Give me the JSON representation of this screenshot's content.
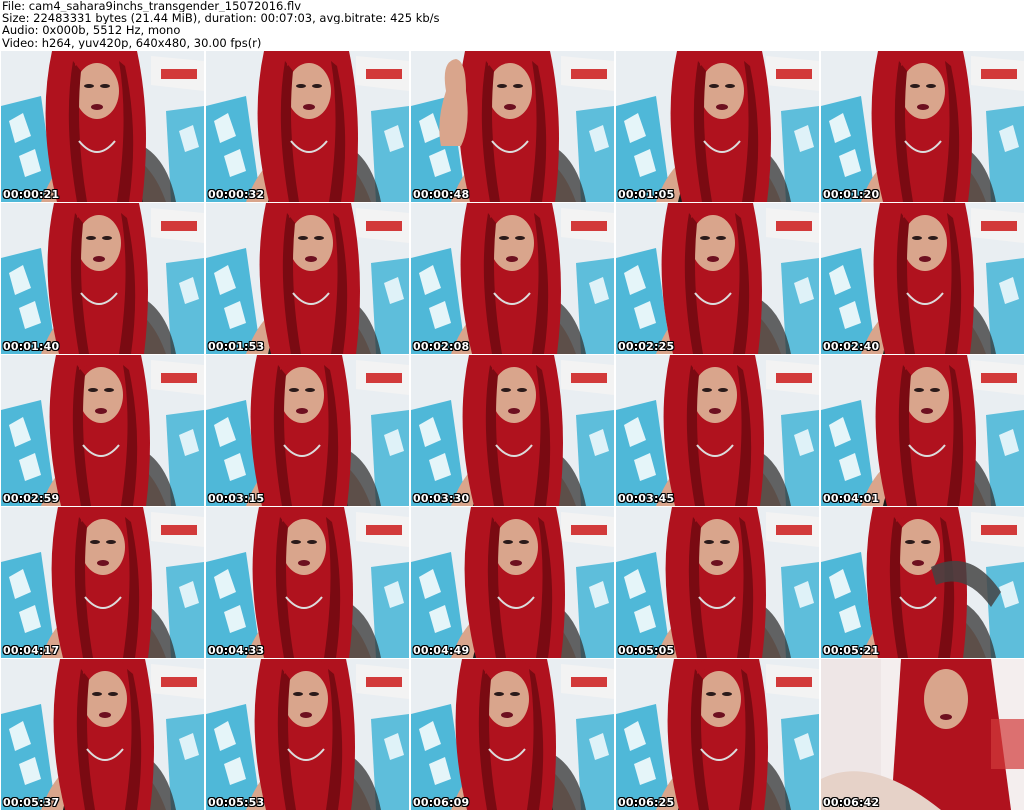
{
  "header": {
    "file": "File: cam4_sahara9inchs_transgender_15072016.flv",
    "size": "Size: 22483331 bytes (21.44 MiB), duration: 00:07:03, avg.bitrate: 425 kb/s",
    "audio": "Audio: 0x000b, 5512 Hz, mono",
    "video": "Video: h264, yuv420p, 640x480, 30.00 fps(r)"
  },
  "colors": {
    "wall": "#e9eef2",
    "blue_fabric": "#4fb8d8",
    "hair": "#b0121e",
    "hair_dark": "#7a0a12",
    "skin": "#d9a58c",
    "top": "#1a1a1a",
    "poster": "#d23a3a"
  },
  "thumbnails": [
    {
      "time": "00:00:21",
      "variant": "default"
    },
    {
      "time": "00:00:32",
      "variant": "default"
    },
    {
      "time": "00:00:48",
      "variant": "hand"
    },
    {
      "time": "00:01:05",
      "variant": "default"
    },
    {
      "time": "00:01:20",
      "variant": "default"
    },
    {
      "time": "00:01:40",
      "variant": "default"
    },
    {
      "time": "00:01:53",
      "variant": "default"
    },
    {
      "time": "00:02:08",
      "variant": "default"
    },
    {
      "time": "00:02:25",
      "variant": "default"
    },
    {
      "time": "00:02:40",
      "variant": "default"
    },
    {
      "time": "00:02:59",
      "variant": "default"
    },
    {
      "time": "00:03:15",
      "variant": "default"
    },
    {
      "time": "00:03:30",
      "variant": "default"
    },
    {
      "time": "00:03:45",
      "variant": "default"
    },
    {
      "time": "00:04:01",
      "variant": "default"
    },
    {
      "time": "00:04:17",
      "variant": "default"
    },
    {
      "time": "00:04:33",
      "variant": "default"
    },
    {
      "time": "00:04:49",
      "variant": "default"
    },
    {
      "time": "00:05:05",
      "variant": "default"
    },
    {
      "time": "00:05:21",
      "variant": "arm"
    },
    {
      "time": "00:05:37",
      "variant": "default"
    },
    {
      "time": "00:05:53",
      "variant": "default"
    },
    {
      "time": "00:06:09",
      "variant": "default"
    },
    {
      "time": "00:06:25",
      "variant": "default"
    },
    {
      "time": "00:06:42",
      "variant": "blur"
    }
  ]
}
